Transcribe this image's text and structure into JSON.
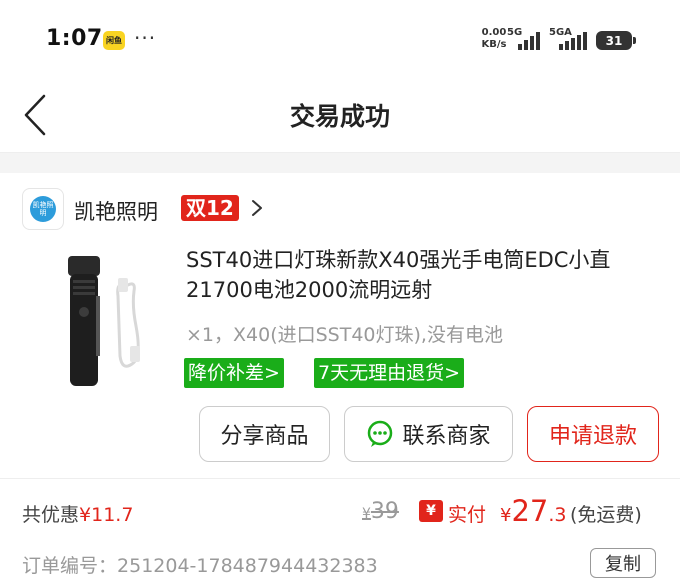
{
  "status_bar": {
    "time": "1:07",
    "notif_badge": "闲鱼",
    "more": "···",
    "net_speed_value": "0.00",
    "net_speed_unit": "KB/s",
    "signal1_label": "5G",
    "signal2_label": "5GA",
    "battery": "31"
  },
  "navbar": {
    "title": "交易成功"
  },
  "shop": {
    "logo_text": "凯艳照明",
    "name": "凯艳照明",
    "promo": "双12"
  },
  "product": {
    "title": "SST40进口灯珠新款X40强光手电筒EDC小直21700电池2000流明远射",
    "spec": "×1，X40(进口SST40灯珠),没有电池",
    "tags": [
      "降价补差>",
      "7天无理由退货>"
    ]
  },
  "actions": {
    "share": "分享商品",
    "contact": "联系商家",
    "refund": "申请退款"
  },
  "price": {
    "discount_label": "共优惠",
    "discount_value": "¥11.7",
    "original_symbol": "¥",
    "original_value": "39",
    "paid_label": "实付",
    "paid_symbol": "¥",
    "paid_int": "27",
    "paid_dec": ".3",
    "shipping": "(免运费)"
  },
  "order": {
    "label": "订单编号：",
    "number": "251204-178487944432383",
    "copy": "复制"
  },
  "colors": {
    "accent_red": "#e1251b",
    "tag_green": "#1aad19"
  }
}
